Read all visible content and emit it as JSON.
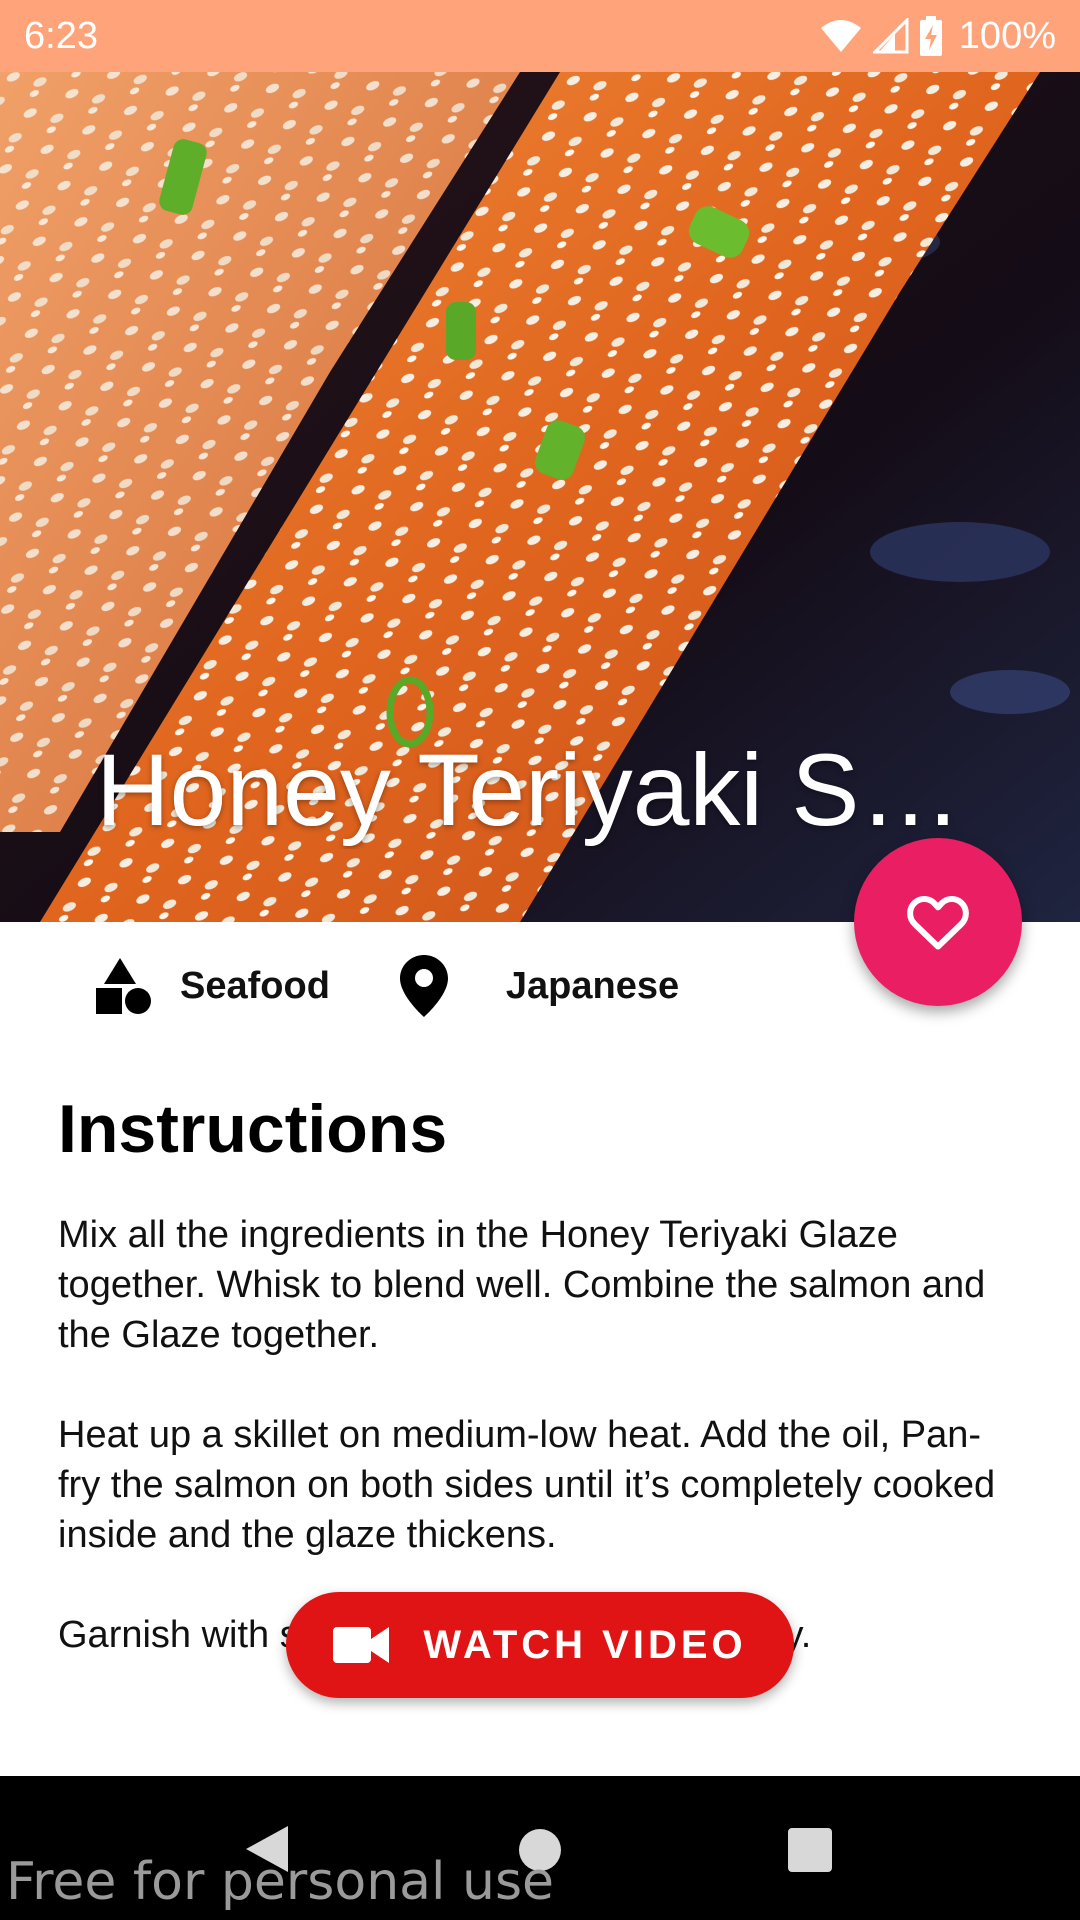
{
  "status_bar": {
    "time": "6:23",
    "battery": "100%",
    "icons": [
      "wifi-icon",
      "signal-icon",
      "battery-charging-icon"
    ]
  },
  "recipe": {
    "title": "Honey Teriyaki Sa...",
    "category": "Seafood",
    "area": "Japanese"
  },
  "instructions": {
    "heading": "Instructions",
    "paragraphs": [
      "Mix all the ingredients in the Honey Teriyaki Glaze together. Whisk to blend well. Combine the salmon and the Glaze together.",
      "Heat up a skillet on medium-low heat. Add the oil, Pan-fry the salmon on both sides until it’s completely cooked inside and the glaze thickens.",
      "Garnish with sesame and serve immediately."
    ]
  },
  "actions": {
    "favorite_icon": "heart-outline-icon",
    "watch_video_label": "WATCH VIDEO",
    "watch_video_icon": "videocam-icon"
  },
  "nav_bar": {
    "buttons": [
      "back-icon",
      "home-icon",
      "recents-icon"
    ]
  },
  "watermark": "Free for personal use",
  "colors": {
    "status_bar": "#ffa47a",
    "favorite_fab": "#e91e63",
    "watch_button": "#e01414"
  }
}
